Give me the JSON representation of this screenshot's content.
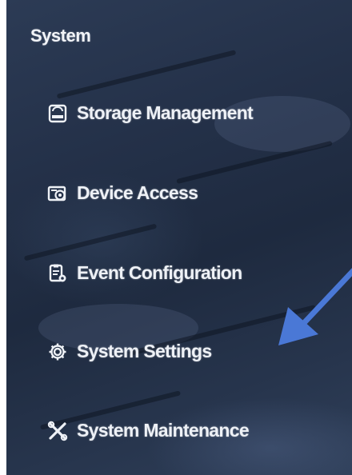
{
  "section": {
    "title": "System"
  },
  "menu": {
    "items": [
      {
        "label": "Storage Management",
        "icon": "storage-icon"
      },
      {
        "label": "Device Access",
        "icon": "device-access-icon"
      },
      {
        "label": "Event Configuration",
        "icon": "event-config-icon"
      },
      {
        "label": "System Settings",
        "icon": "gear-icon"
      },
      {
        "label": "System Maintenance",
        "icon": "tools-icon"
      }
    ]
  },
  "colors": {
    "background": "#243149",
    "text": "#eef1f6",
    "annotation_arrow": "#4a78d6"
  }
}
